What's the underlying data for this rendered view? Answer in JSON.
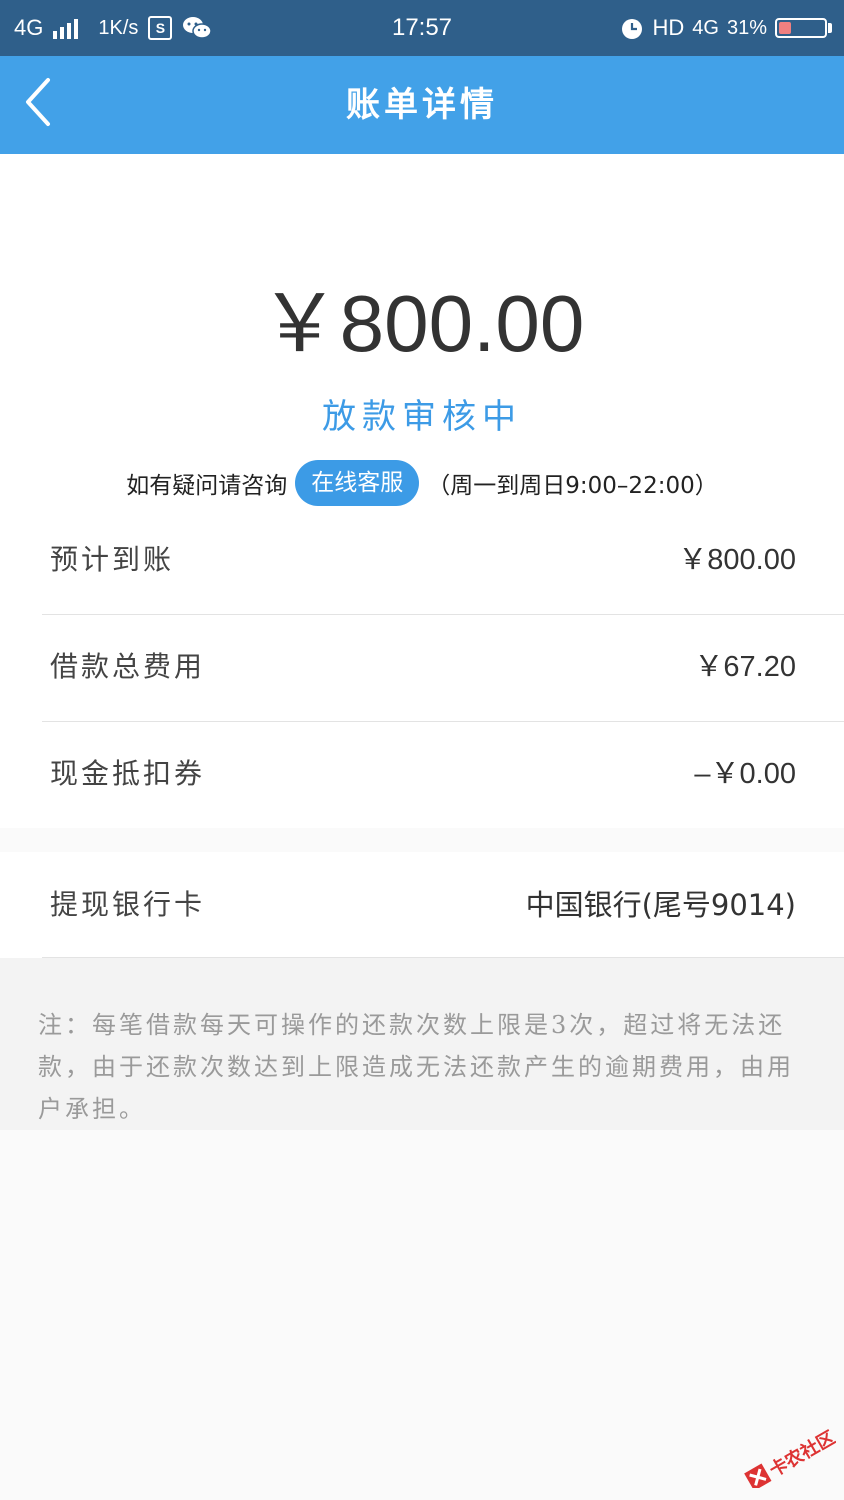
{
  "status_bar": {
    "network": "4G",
    "speed": "1K/s",
    "sim_icon": "S",
    "time": "17:57",
    "hd": "HD",
    "network_right": "4G",
    "battery": "31%"
  },
  "nav": {
    "title": "账单详情"
  },
  "summary": {
    "amount": "￥800.00",
    "status": "放款审核中",
    "consult_prefix": "如有疑问请咨询",
    "online_service": "在线客服",
    "hours": "（周一到周日9:00–22:00）"
  },
  "rows": [
    {
      "label": "预计到账",
      "value": "￥800.00"
    },
    {
      "label": "借款总费用",
      "value": "￥67.20"
    },
    {
      "label": "现金抵扣券",
      "value": "–￥0.00"
    }
  ],
  "bank": {
    "label": "提现银行卡",
    "value": "中国银行(尾号9014)"
  },
  "note": "注：每笔借款每天可操作的还款次数上限是3次，超过将无法还款，由于还款次数达到上限造成无法还款产生的逾期费用，由用户承担。",
  "watermark": "卡农社区",
  "colors": {
    "status_bar": "#2f5f8a",
    "nav_bar": "#42a1e8",
    "accent": "#3c9be6"
  }
}
